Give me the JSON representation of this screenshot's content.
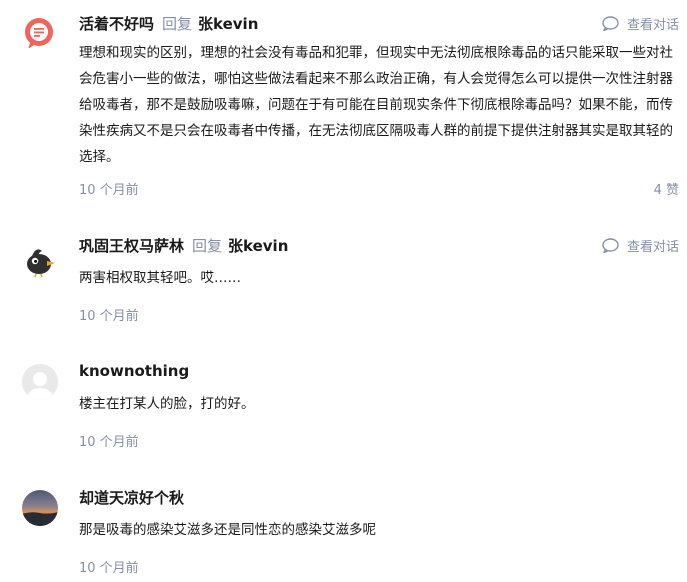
{
  "comments": [
    {
      "author": "活着不好吗",
      "reply_word": "回复",
      "reply_to": "张kevin",
      "conversation_label": "查看对话",
      "body": "理想和现实的区别，理想的社会没有毒品和犯罪，但现实中无法彻底根除毒品的话只能采取一些对社会危害小一些的做法，哪怕这些做法看起来不那么政治正确，有人会觉得怎么可以提供一次性注射器给吸毒者，那不是鼓励吸毒嘛，问题在于有可能在目前现实条件下彻底根除毒品吗？如果不能，而传染性疾病又不是只会在吸毒者中传播，在无法彻底区隔吸毒人群的前提下提供注射器其实是取其轻的选择。",
      "time": "10 个月前",
      "likes": "4 赞"
    },
    {
      "author": "巩固王权马萨林",
      "reply_word": "回复",
      "reply_to": "张kevin",
      "conversation_label": "查看对话",
      "body": "两害相权取其轻吧。哎……",
      "time": "10 个月前"
    },
    {
      "author": "knownothing",
      "body": "楼主在打某人的脸，打的好。",
      "time": "10 个月前"
    },
    {
      "author": "却道天凉好个秋",
      "body": "那是吸毒的感染艾滋多还是同性恋的感染艾滋多呢",
      "time": "10 个月前"
    }
  ],
  "colors": {
    "text": "#1a1a1a",
    "meta": "#8590a6",
    "avatar_red": "#f0645a"
  }
}
